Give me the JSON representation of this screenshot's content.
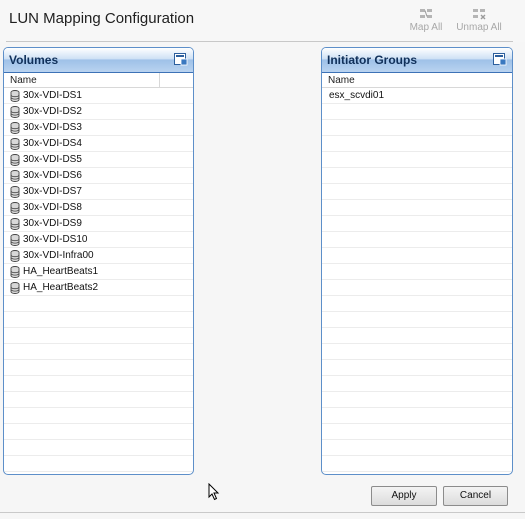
{
  "header": {
    "title": "LUN Mapping Configuration",
    "map_all_label": "Map All",
    "unmap_all_label": "Unmap All"
  },
  "volumes_panel": {
    "title": "Volumes",
    "column_name": "Name",
    "items": [
      "30x-VDI-DS1",
      "30x-VDI-DS2",
      "30x-VDI-DS3",
      "30x-VDI-DS4",
      "30x-VDI-DS5",
      "30x-VDI-DS6",
      "30x-VDI-DS7",
      "30x-VDI-DS8",
      "30x-VDI-DS9",
      "30x-VDI-DS10",
      "30x-VDI-Infra00",
      "HA_HeartBeats1",
      "HA_HeartBeats2"
    ]
  },
  "initiator_panel": {
    "title": "Initiator Groups",
    "column_name": "Name",
    "items": [
      "esx_scvdi01"
    ]
  },
  "buttons": {
    "apply": "Apply",
    "cancel": "Cancel"
  },
  "colors": {
    "panel_border": "#5d8fc9",
    "panel_header": "#b9d3f0",
    "database_icon": "#444444",
    "disabled_tool": "#a8a8a8"
  }
}
